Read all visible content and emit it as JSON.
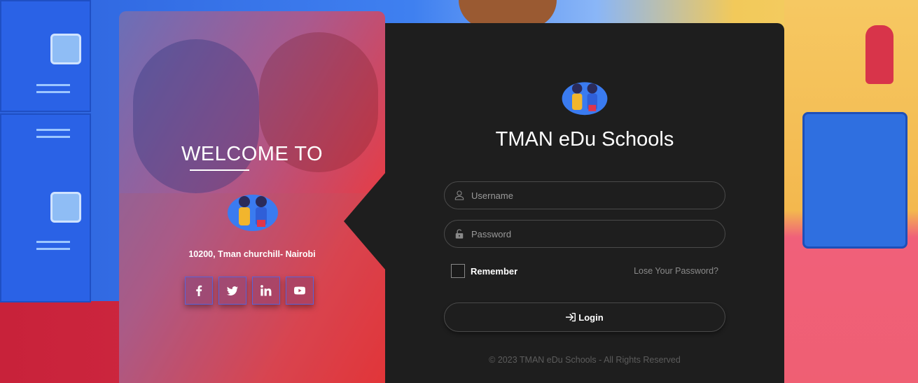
{
  "left": {
    "welcome": "WELCOME TO",
    "address": "10200, Tman churchill- Nairobi",
    "socials": [
      {
        "icon": "facebook-icon"
      },
      {
        "icon": "twitter-icon"
      },
      {
        "icon": "linkedin-icon"
      },
      {
        "icon": "youtube-icon"
      }
    ]
  },
  "right": {
    "brand": "TMAN eDu Schools",
    "username": {
      "placeholder": "Username",
      "value": ""
    },
    "password": {
      "placeholder": "Password",
      "value": ""
    },
    "remember_label": "Remember",
    "lose_password": "Lose Your Password?",
    "login_label": "Login",
    "footer": "© 2023 TMAN eDu Schools - All Rights Reserved"
  },
  "colors": {
    "panel_dark": "#1e1e1e",
    "accent_red": "#ee2b2d",
    "accent_blue": "#5a63d8"
  }
}
